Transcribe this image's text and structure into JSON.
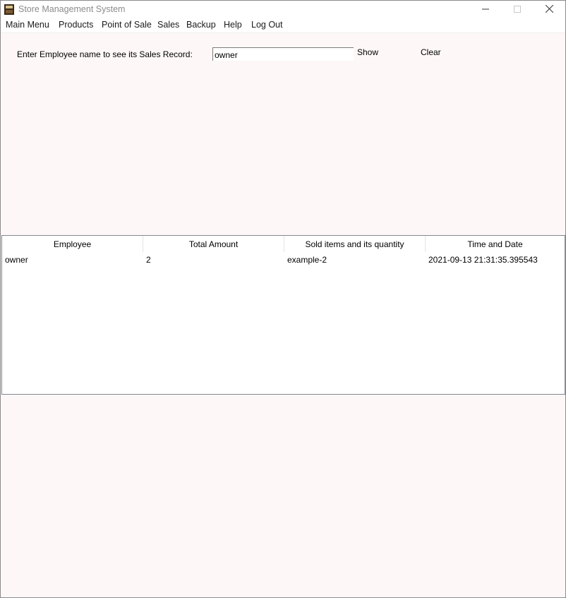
{
  "window": {
    "title": "Store Management System",
    "app_icon": "cash-register-icon",
    "controls": {
      "minimize_icon": "minimize-icon",
      "maximize_icon": "maximize-icon",
      "close_icon": "close-icon"
    }
  },
  "menu": {
    "items": [
      {
        "label": "Main Menu"
      },
      {
        "label": "Products"
      },
      {
        "label": "Point of Sale"
      },
      {
        "label": "Sales"
      },
      {
        "label": "Backup"
      },
      {
        "label": "Help"
      },
      {
        "label": "Log Out"
      }
    ]
  },
  "search": {
    "label": "Enter Employee name to see its Sales Record:",
    "value": "owner",
    "show_label": "Show",
    "clear_label": "Clear"
  },
  "table": {
    "columns": [
      "Employee",
      "Total Amount",
      "Sold items and its quantity",
      "Time and Date"
    ],
    "rows": [
      [
        "owner",
        "2",
        "example-2",
        "2021-09-13 21:31:35.395543"
      ]
    ]
  },
  "colors": {
    "window_background": "#fdf8f7",
    "table_border": "#828790"
  }
}
